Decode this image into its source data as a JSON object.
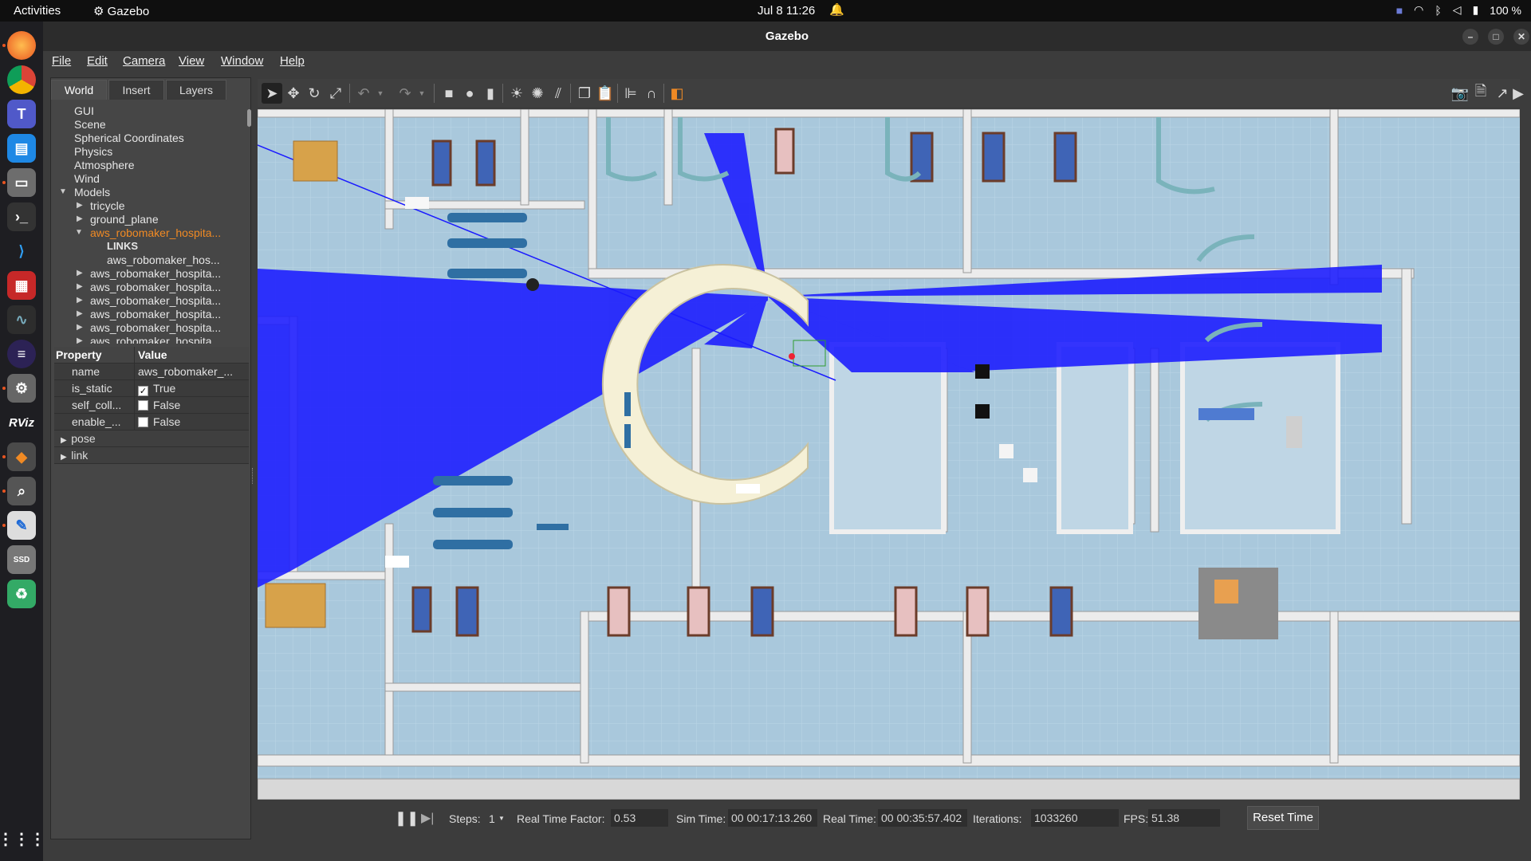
{
  "topbar": {
    "activities": "Activities",
    "app": "Gazebo",
    "clock": "Jul 8  11:26",
    "battery": "100 %"
  },
  "window": {
    "title": "Gazebo"
  },
  "menu": [
    "File",
    "Edit",
    "Camera",
    "View",
    "Window",
    "Help"
  ],
  "tabs": [
    "World",
    "Insert",
    "Layers"
  ],
  "tree": {
    "items": [
      "GUI",
      "Scene",
      "Spherical Coordinates",
      "Physics",
      "Atmosphere",
      "Wind"
    ],
    "models_label": "Models",
    "models": [
      "tricycle",
      "ground_plane"
    ],
    "selected": "aws_robomaker_hospita...",
    "links_label": "LINKS",
    "link_child": "aws_robomaker_hos...",
    "more_models": [
      "aws_robomaker_hospita...",
      "aws_robomaker_hospita...",
      "aws_robomaker_hospita...",
      "aws_robomaker_hospita...",
      "aws_robomaker_hospita...",
      "aws_robomaker_hospita..."
    ]
  },
  "properties": {
    "header_property": "Property",
    "header_value": "Value",
    "rows": [
      {
        "name": "name",
        "value": "aws_robomaker_...",
        "checkbox": false
      },
      {
        "name": "is_static",
        "value": "True",
        "checkbox": true,
        "checked": true
      },
      {
        "name": "self_coll...",
        "value": "False",
        "checkbox": true,
        "checked": false
      },
      {
        "name": "enable_...",
        "value": "False",
        "checkbox": true,
        "checked": false
      }
    ],
    "groups": [
      "pose",
      "link"
    ]
  },
  "status": {
    "steps_label": "Steps:",
    "steps_value": "1",
    "rtf_label": "Real Time Factor:",
    "rtf_value": "0.53",
    "sim_time_label": "Sim Time:",
    "sim_time_value": "00 00:17:13.260",
    "real_time_label": "Real Time:",
    "real_time_value": "00 00:35:57.402",
    "iterations_label": "Iterations:",
    "iterations_value": "1033260",
    "fps_label": "FPS:",
    "fps_value": "51.38",
    "reset_label": "Reset Time"
  },
  "colors": {
    "selected_text": "#f08a24",
    "laser": "#1a1aff",
    "floor": "#a9c8dc",
    "wall": "#eeeeee"
  }
}
